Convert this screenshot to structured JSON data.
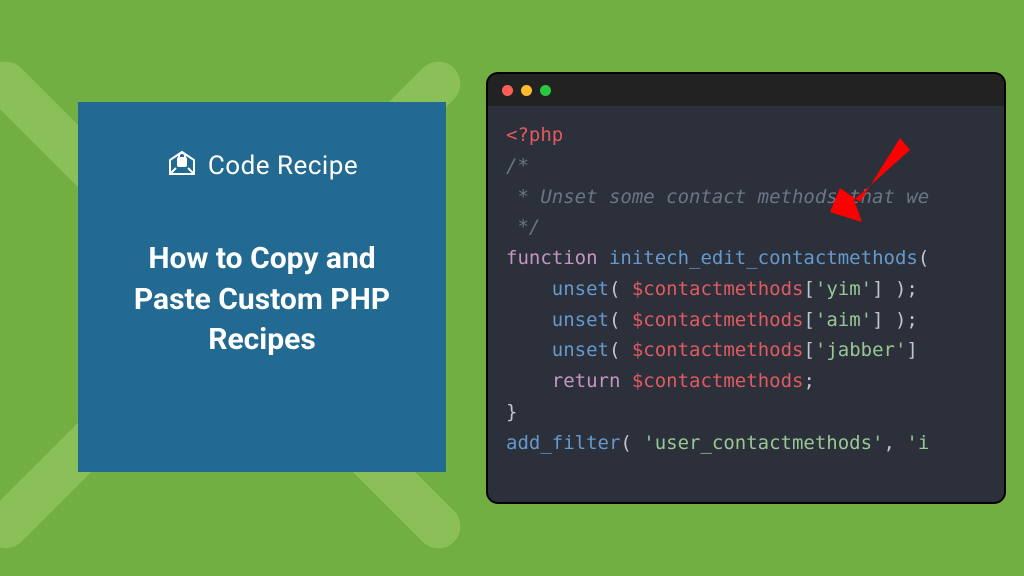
{
  "brand": {
    "name": "Code Recipe"
  },
  "card": {
    "title": "How to Copy and Paste Custom PHP Recipes"
  },
  "code": {
    "php_open": "<?php",
    "cm1": "/*",
    "cm2": " * Unset some contact methods that we",
    "cm3": " */",
    "kw_function": "function",
    "fn_name": "initech_edit_contactmethods",
    "unset": "unset",
    "var": "$contactmethods",
    "k_yim": "'yim'",
    "k_aim": "'aim'",
    "k_jabber": "'jabber'",
    "kw_return": "return",
    "add_filter": "add_filter",
    "hook": "'user_contactmethods'",
    "cb_prefix": "'i"
  },
  "colors": {
    "bg": "#72af42",
    "card": "#226a91",
    "editor": "#2b303b",
    "arrow": "#ff0000"
  }
}
